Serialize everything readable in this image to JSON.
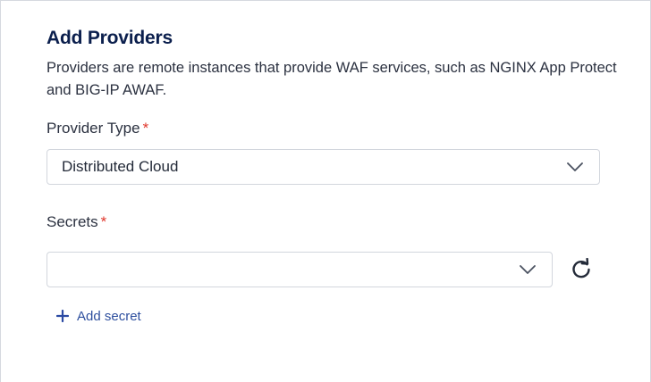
{
  "form": {
    "title": "Add Providers",
    "description": "Providers are remote instances that provide WAF services, such as NGINX App Protect and BIG-IP AWAF.",
    "provider_type": {
      "label": "Provider Type",
      "required_mark": "*",
      "selected_value": "Distributed Cloud",
      "icon": "chevron-down-icon"
    },
    "secrets": {
      "label": "Secrets",
      "required_mark": "*",
      "selected_value": "",
      "icon": "chevron-down-icon",
      "refresh_icon": "refresh-icon"
    },
    "add_secret": {
      "label": "Add secret",
      "icon": "plus-icon"
    }
  },
  "colors": {
    "title": "#0b1f4d",
    "required": "#e0362b",
    "link": "#2e4f9e",
    "border": "#d2d6dd"
  }
}
